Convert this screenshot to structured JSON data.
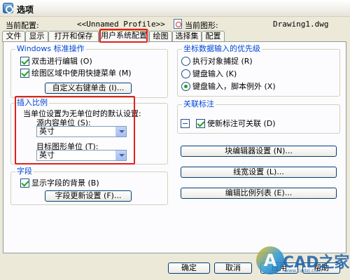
{
  "window": {
    "title": "选项"
  },
  "profile": {
    "label": "当前配置:",
    "value": "<<Unnamed Profile>>"
  },
  "drawing": {
    "label": "当前图形:",
    "value": "Drawing1.dwg"
  },
  "tabs": [
    "文件",
    "显示",
    "打开和保存",
    "用户系统配置",
    "绘图",
    "选择集",
    "配置"
  ],
  "active_tab": "用户系统配置",
  "windows_ops": {
    "title": "Windows 标准操作",
    "dblclick_edit": {
      "label": "双击进行编辑 (O)",
      "checked": true
    },
    "shortcut_menu": {
      "label": "绘图区域中使用快捷菜单 (M)",
      "checked": true
    },
    "right_click_button": "自定义右键单击 (I)..."
  },
  "insert_scale": {
    "title": "插入比例",
    "description": "当单位设置为无单位时的默认设置:",
    "source_label": "源内容单位 (S):",
    "source_value": "英寸",
    "target_label": "目标图形单位 (T):",
    "target_value": "英寸"
  },
  "fields": {
    "title": "字段",
    "show_background": {
      "label": "显示字段的背景 (B)",
      "checked": true
    },
    "update_button": "字段更新设置 (F)..."
  },
  "coord_priority": {
    "title": "坐标数据输入的优先级",
    "options": [
      "执行对象捕捉 (R)",
      "键盘输入 (K)",
      "键盘输入，脚本例外 (X)"
    ],
    "selected_index": 2
  },
  "assoc_dim": {
    "title": "关联标注",
    "new_assoc": {
      "label": "使新标注可关联 (D)",
      "checked": true
    }
  },
  "right_buttons": {
    "block_editor": "块编辑器设置 (N)...",
    "lineweight": "线宽设置 (L)...",
    "scale_list": "编辑比例列表 (E)..."
  },
  "dialog_buttons": {
    "ok": "确定",
    "cancel": "取消",
    "apply": "应用",
    "help": "帮助"
  },
  "watermark": {
    "logo_letter": "A",
    "text": "CAD之家",
    "url": "www.cadzj.com"
  },
  "colors": {
    "group_title": "#0046d5",
    "highlight": "#e0201a",
    "tab_active_border": "#e68b2c"
  }
}
